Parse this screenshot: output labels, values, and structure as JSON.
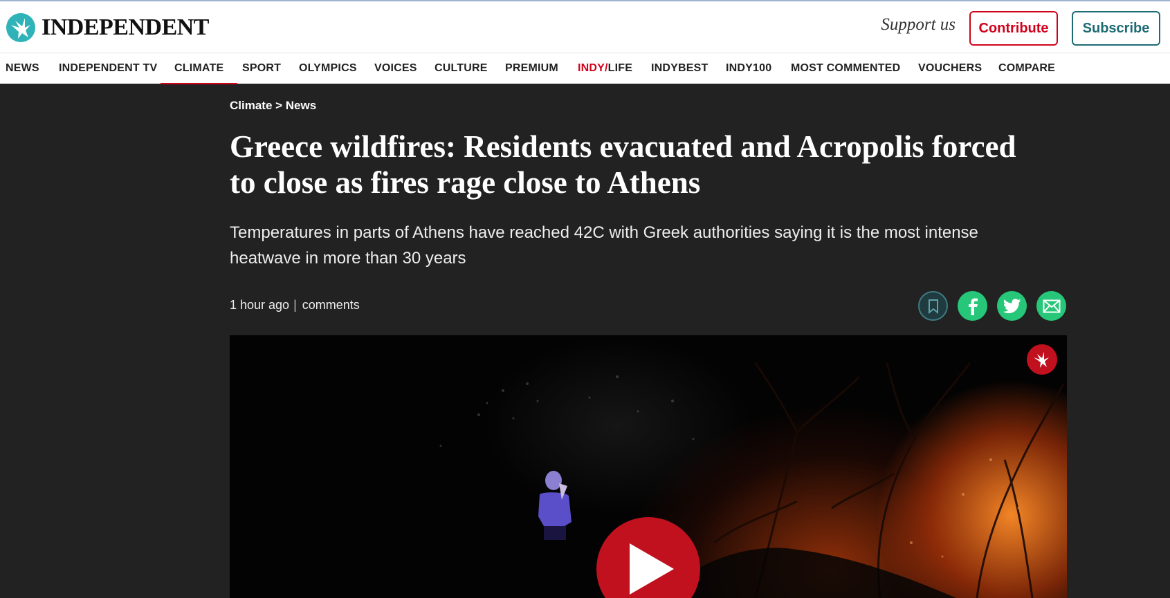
{
  "header": {
    "logo_text": "INDEPENDENT",
    "support_text": "Support us",
    "contribute_label": "Contribute",
    "subscribe_label": "Subscribe"
  },
  "nav": {
    "items": [
      {
        "label": "NEWS"
      },
      {
        "label": "INDEPENDENT TV"
      },
      {
        "label": "CLIMATE",
        "active": true
      },
      {
        "label": "SPORT"
      },
      {
        "label": "OLYMPICS"
      },
      {
        "label": "VOICES"
      },
      {
        "label": "CULTURE"
      },
      {
        "label": "PREMIUM"
      },
      {
        "label_red": "INDY/",
        "label": "LIFE"
      },
      {
        "label": "INDYBEST"
      },
      {
        "label": "INDY100"
      },
      {
        "label": "MOST COMMENTED"
      },
      {
        "label": "VOUCHERS"
      },
      {
        "label": "COMPARE"
      }
    ]
  },
  "article": {
    "breadcrumb": "Climate > News",
    "headline": "Greece wildfires: Residents evacuated and Acropolis forced to close as fires rage close to Athens",
    "standfirst": "Temperatures in parts of Athens have reached 42C with Greek authorities saying it is the most intense heatwave in more than 30 years",
    "time": "1 hour ago",
    "separator": "|",
    "comments": "comments",
    "share_icons": [
      "bookmark-icon",
      "facebook-icon",
      "twitter-icon",
      "email-icon"
    ]
  },
  "video": {
    "logo_icon": "independent-eagle-icon",
    "play_icon": "play-icon"
  },
  "colors": {
    "accent_red": "#d0021b",
    "subscribe_teal": "#1d6b73",
    "share_green": "#27c77a",
    "page_background": "#222222"
  }
}
